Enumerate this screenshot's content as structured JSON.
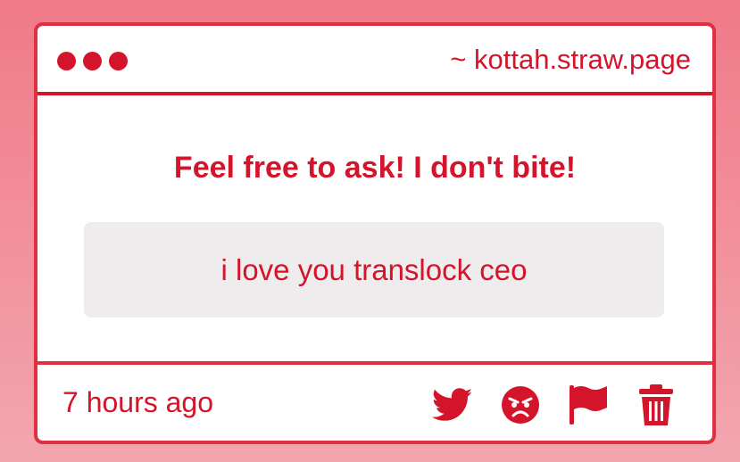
{
  "window": {
    "url": "~ kottah.straw.page"
  },
  "question": {
    "heading": "Feel free to ask! I don't bite!",
    "text": "i love you translock ceo"
  },
  "footer": {
    "time": "7 hours ago",
    "actions": [
      {
        "icon": "twitter-icon"
      },
      {
        "icon": "angry-face-icon"
      },
      {
        "icon": "flag-icon"
      },
      {
        "icon": "trash-icon"
      }
    ]
  },
  "colors": {
    "accent": "#d4142a",
    "border": "#df2f40",
    "question_bg": "#eeeced"
  }
}
